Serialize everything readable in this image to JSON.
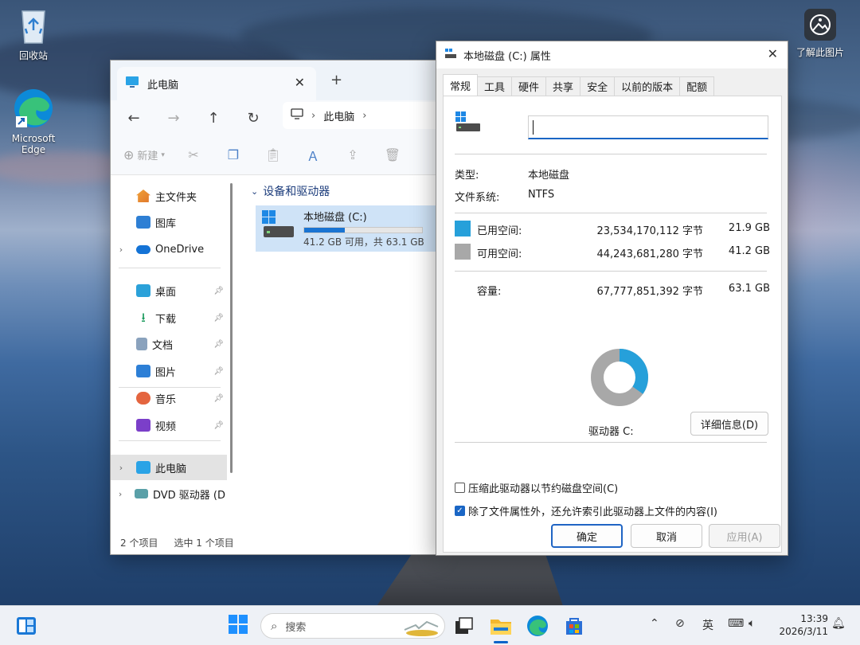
{
  "desktop": {
    "recycle_bin_label": "回收站",
    "edge_label": "Microsoft Edge",
    "learn_label": "了解此图片"
  },
  "explorer": {
    "tab_title": "此电脑",
    "address_label": "此电脑",
    "toolbar": {
      "new_label": "新建"
    },
    "sidebar": {
      "items": [
        {
          "label": "主文件夹"
        },
        {
          "label": "图库"
        },
        {
          "label": "OneDrive"
        },
        {
          "label": "桌面"
        },
        {
          "label": "下载"
        },
        {
          "label": "文档"
        },
        {
          "label": "图片"
        },
        {
          "label": "音乐"
        },
        {
          "label": "视频"
        },
        {
          "label": "此电脑"
        },
        {
          "label": "DVD 驱动器 (D"
        }
      ]
    },
    "group_title": "设备和驱动器",
    "drive": {
      "name": "本地磁盘 (C:)",
      "free_text": "41.2 GB 可用，共 63.1 GB",
      "used_fraction": 0.347
    },
    "status": {
      "count": "2 个项目",
      "selected": "选中 1 个项目"
    }
  },
  "properties": {
    "title": "本地磁盘 (C:) 属性",
    "tabs": [
      "常规",
      "工具",
      "硬件",
      "共享",
      "安全",
      "以前的版本",
      "配额"
    ],
    "name_value": "",
    "type_label": "类型:",
    "type_value": "本地磁盘",
    "fs_label": "文件系统:",
    "fs_value": "NTFS",
    "used": {
      "label": "已用空间:",
      "bytes": "23,534,170,112 字节",
      "gb": "21.9 GB",
      "color": "#26a0da"
    },
    "free": {
      "label": "可用空间:",
      "bytes": "44,243,681,280 字节",
      "gb": "41.2 GB",
      "color": "#a8a8a8"
    },
    "capacity": {
      "label": "容量:",
      "bytes": "67,777,851,392 字节",
      "gb": "63.1 GB"
    },
    "used_fraction": 0.347,
    "drive_label": "驱动器 C:",
    "details_button": "详细信息(D)",
    "compress_label": "压缩此驱动器以节约磁盘空间(C)",
    "compress_checked": false,
    "index_label": "除了文件属性外，还允许索引此驱动器上文件的内容(I)",
    "index_checked": true,
    "ok_button": "确定",
    "cancel_button": "取消",
    "apply_button": "应用(A)"
  },
  "taskbar": {
    "search_placeholder": "搜索",
    "ime": "英",
    "time": "13:39",
    "date": "2026/3/11"
  }
}
